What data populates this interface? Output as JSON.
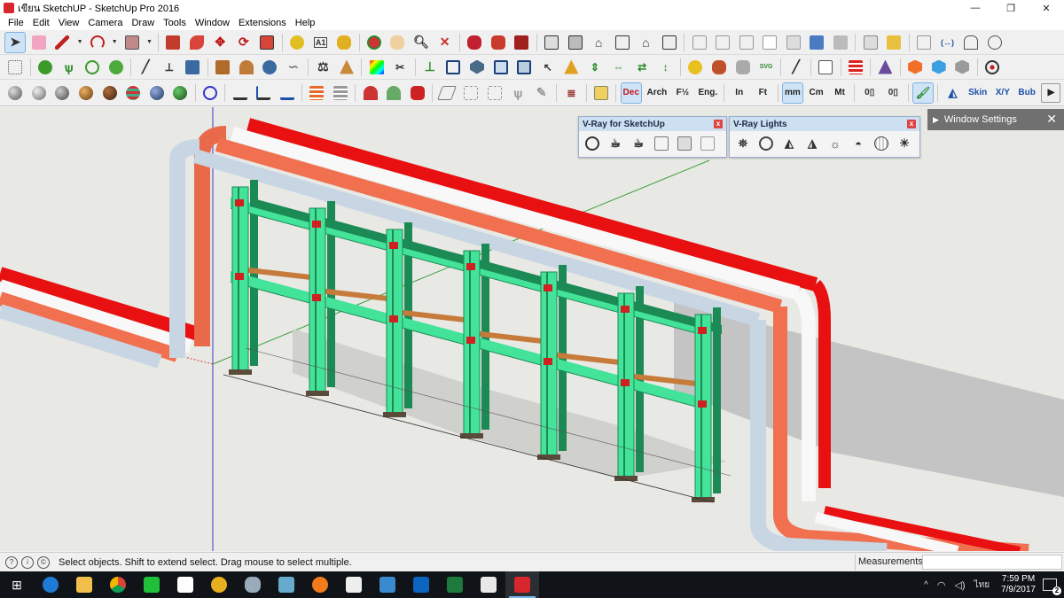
{
  "window": {
    "title": "เขียน SketchUP - SketchUp Pro 2016",
    "controls": [
      "—",
      "❐",
      "✕"
    ]
  },
  "menu": [
    "File",
    "Edit",
    "View",
    "Camera",
    "Draw",
    "Tools",
    "Window",
    "Extensions",
    "Help"
  ],
  "toolbar_text": {
    "dec": "Dec",
    "arch": "Arch",
    "frac": "F½",
    "eng": "Eng.",
    "in": "In",
    "ft": "Ft",
    "mm": "mm",
    "cm": "Cm",
    "mt": "Mt",
    "skin": "Skin",
    "xy": "X/Y",
    "bub": "Bub",
    "svg": "SVG",
    "play": "▶"
  },
  "vray_panel": {
    "title": "V-Ray for SketchUp",
    "close": "x"
  },
  "vray_lights_panel": {
    "title": "V-Ray Lights",
    "close": "x"
  },
  "window_settings": {
    "label": "Window Settings",
    "arrow": "▶",
    "close": "✕"
  },
  "status": {
    "icons": [
      "?",
      "i",
      "©"
    ],
    "message": "Select objects. Shift to extend select. Drag mouse to select multiple.",
    "measurements_label": "Measurements"
  },
  "taskbar": {
    "tray_up": "^",
    "input_lang": "ไทย",
    "time": "7:59 PM",
    "date": "7/9/2017",
    "notifications": "2"
  },
  "colors": {
    "frame": "#43e39a",
    "frame_dark": "#1c8a55",
    "beam": "#c77b3a",
    "pipe_light": "#c8d6e4",
    "pipe_orange": "#f07050",
    "pipe_white": "#f8f8f8",
    "pipe_red": "#e81010",
    "shadow": "#bdbdbd"
  }
}
